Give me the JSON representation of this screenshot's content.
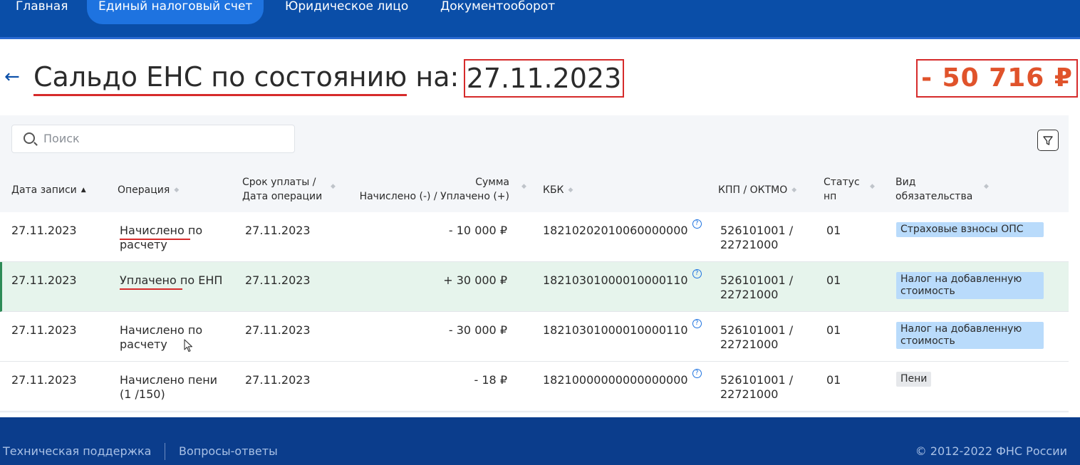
{
  "nav": {
    "tabs": [
      {
        "label": "Главная"
      },
      {
        "label": "Единый налоговый счет"
      },
      {
        "label": "Юридическое лицо"
      },
      {
        "label": "Документооборот"
      }
    ]
  },
  "header": {
    "title_main": "Сальдо ЕНС по состоянию",
    "title_suffix": " на:",
    "date": "27.11.2023",
    "balance": "- 50 716 ₽",
    "balance_color": "#e0532b"
  },
  "search": {
    "placeholder": "Поиск"
  },
  "table": {
    "columns": {
      "date": "Дата записи",
      "operation": "Операция",
      "due_1": "Срок уплаты /",
      "due_2": "Дата операции",
      "sum_1": "Сумма",
      "sum_2": "Начислено (-) / Уплачено (+)",
      "kbk": "КБК",
      "kpp": "КПП / ОКТМО",
      "status_1": "Статус",
      "status_2": "нп",
      "type_1": "Вид",
      "type_2": "обязательства"
    },
    "rows": [
      {
        "date": "27.11.2023",
        "op_1": "Начислено по",
        "op_2": "расчету",
        "due": "27.11.2023",
        "sum": "- 10 000 ₽",
        "kbk": "18210202010060000000",
        "kpp_1": "526101001 /",
        "kpp_2": "22721000",
        "status": "01",
        "type": "Страховые взносы ОПС"
      },
      {
        "date": "27.11.2023",
        "op_1": "Уплачено по ЕНП",
        "op_2": "",
        "due": "27.11.2023",
        "sum": "+ 30 000 ₽",
        "kbk": "18210301000010000110",
        "kpp_1": "526101001 /",
        "kpp_2": "22721000",
        "status": "01",
        "type": "Налог на добавленную стоимость"
      },
      {
        "date": "27.11.2023",
        "op_1": "Начислено по",
        "op_2": "расчету",
        "due": "27.11.2023",
        "sum": "- 30 000 ₽",
        "kbk": "18210301000010000110",
        "kpp_1": "526101001 /",
        "kpp_2": "22721000",
        "status": "01",
        "type": "Налог на добавленную стоимость"
      },
      {
        "date": "27.11.2023",
        "op_1": "Начислено пени",
        "op_2": "(1 /150)",
        "due": "27.11.2023",
        "sum": "- 18 ₽",
        "kbk": "18210000000000000000",
        "kpp_1": "526101001 /",
        "kpp_2": "22721000",
        "status": "01",
        "type": "Пени"
      }
    ]
  },
  "footer": {
    "support": "Техническая поддержка",
    "faq": "Вопросы-ответы",
    "copyright": "© 2012-2022 ФНС России"
  }
}
